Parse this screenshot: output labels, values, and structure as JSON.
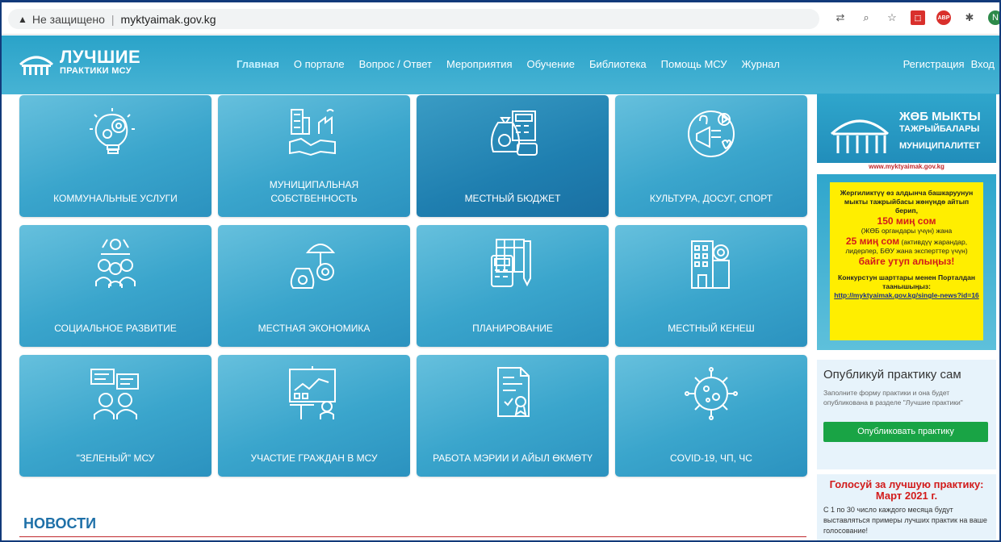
{
  "browser": {
    "insecure_label": "Не защищено",
    "host": "myktyaimak.gov.kg",
    "profile_initial": "N"
  },
  "site": {
    "logo_line1": "ЛУЧШИЕ",
    "logo_line2": "ПРАКТИКИ МСУ",
    "nav": [
      "Главная",
      "О портале",
      "Вопрос / Ответ",
      "Мероприятия",
      "Обучение",
      "Библиотека",
      "Помощь МСУ",
      "Журнал"
    ],
    "auth": [
      "Регистрация",
      "Вход"
    ]
  },
  "tiles": [
    {
      "label": "КОММУНАЛЬНЫЕ УСЛУГИ",
      "icon": "lightbulb-gears-icon"
    },
    {
      "label": "МУНИЦИПАЛЬНАЯ СОБСТВЕННОСТЬ",
      "icon": "handshake-buildings-icon"
    },
    {
      "label": "МЕСТНЫЙ БЮДЖЕТ",
      "icon": "money-bag-calculator-icon"
    },
    {
      "label": "КУЛЬТУРА, ДОСУГ, СПОРТ",
      "icon": "megaphone-icon"
    },
    {
      "label": "СОЦИАЛЬНОЕ РАЗВИТИЕ",
      "icon": "people-network-icon"
    },
    {
      "label": "МЕСТНАЯ ЭКОНОМИКА",
      "icon": "umbrella-money-icon"
    },
    {
      "label": "ПЛАНИРОВАНИЕ",
      "icon": "calculator-plan-icon"
    },
    {
      "label": "МЕСТНЫЙ КЕНЕШ",
      "icon": "building-award-icon"
    },
    {
      "label": "\"ЗЕЛЕНЫЙ\" МСУ",
      "icon": "people-chat-icon"
    },
    {
      "label": "УЧАСТИЕ ГРАЖДАН В МСУ",
      "icon": "presentation-icon"
    },
    {
      "label": "РАБОТА МЭРИИ И АЙЫЛ ӨКМӨТҮ",
      "icon": "certificate-icon"
    },
    {
      "label": "COVID-19, ЧП, ЧС",
      "icon": "virus-icon"
    }
  ],
  "banner1": {
    "line1": "ЖӨБ МЫКТЫ",
    "line2": "ТАЖРЫЙБАЛАРЫ",
    "line3": "МУНИЦИПАЛИТЕТ",
    "url": "www.myktyaimak.gov.kg"
  },
  "banner2": {
    "p1": "Жергиликтүү өз алдынча башкаруунун мыкты тажрыйбасы жөнүндө айтып берип,",
    "amount1": "150 миң сом",
    "p2": "(ЖӨБ органдары үчүн) жана",
    "amount2": "25 миң сом",
    "p3": "(активдүү жарандар, лидерлер, БӨУ жана эксперттер үчүн)",
    "cta": "байге утуп алыңыз!",
    "p4": "Конкурстун шарттары менен Порталдан таанышыңыз:",
    "link": "http://myktyaimak.gov.kg/single-news?id=16"
  },
  "publish": {
    "heading": "Опубликуй практику сам",
    "text": "Заполните форму практики и она будет опубликована в разделе \"Лучшие практики\"",
    "button": "Опубликовать практику"
  },
  "vote": {
    "heading": "Голосуй за лучшую практику: Март 2021 г.",
    "text": "С 1 по 30 число каждого месяца будут выставляться примеры лучших практик на ваше голосование!"
  },
  "news": {
    "heading": "НОВОСТИ"
  }
}
